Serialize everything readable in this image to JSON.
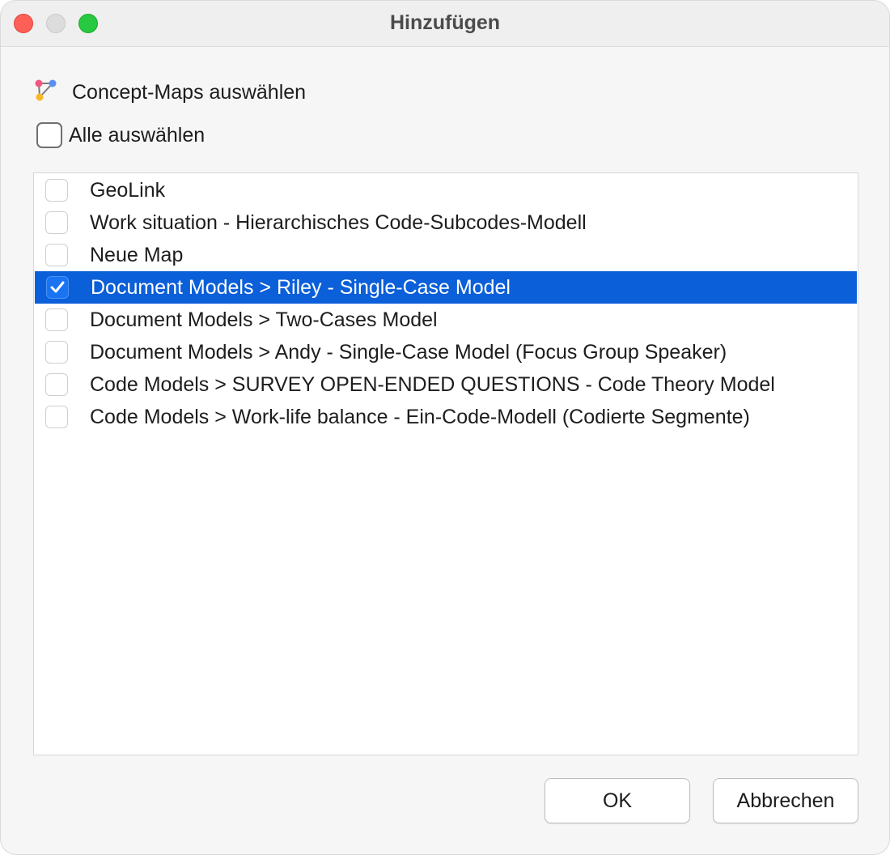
{
  "window": {
    "title": "Hinzufügen"
  },
  "section": {
    "icon": "concept-map-icon",
    "label": "Concept-Maps auswählen"
  },
  "select_all": {
    "label": "Alle auswählen",
    "checked": false
  },
  "items": [
    {
      "label": "GeoLink",
      "checked": false,
      "selected": false
    },
    {
      "label": "Work situation - Hierarchisches Code-Subcodes-Modell",
      "checked": false,
      "selected": false
    },
    {
      "label": "Neue Map",
      "checked": false,
      "selected": false
    },
    {
      "label": "Document Models > Riley - Single-Case Model",
      "checked": true,
      "selected": true
    },
    {
      "label": "Document Models > Two-Cases Model",
      "checked": false,
      "selected": false
    },
    {
      "label": "Document Models > Andy - Single-Case Model (Focus Group Speaker)",
      "checked": false,
      "selected": false
    },
    {
      "label": "Code Models > SURVEY OPEN-ENDED QUESTIONS - Code Theory Model",
      "checked": false,
      "selected": false
    },
    {
      "label": "Code Models > Work-life balance - Ein-Code-Modell (Codierte Segmente)",
      "checked": false,
      "selected": false
    }
  ],
  "buttons": {
    "ok": "OK",
    "cancel": "Abbrechen"
  },
  "colors": {
    "selection": "#0b5fd9",
    "close": "#fe5f57",
    "maximize": "#28c840"
  }
}
